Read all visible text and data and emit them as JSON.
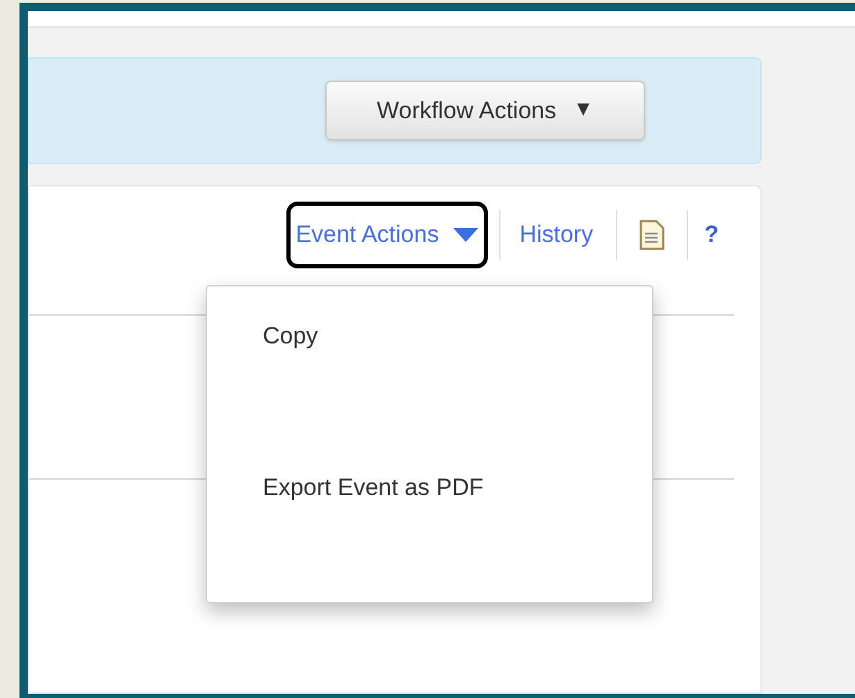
{
  "banner": {
    "workflow_button": {
      "label": "Workflow Actions",
      "caret": "▼"
    }
  },
  "toolbar": {
    "event_actions": {
      "label": "Event Actions",
      "expanded": true
    },
    "history": {
      "label": "History"
    },
    "help": {
      "label": "?"
    }
  },
  "menu": {
    "items": [
      {
        "label": "Copy"
      },
      {
        "label": "Export Event as PDF"
      }
    ]
  }
}
